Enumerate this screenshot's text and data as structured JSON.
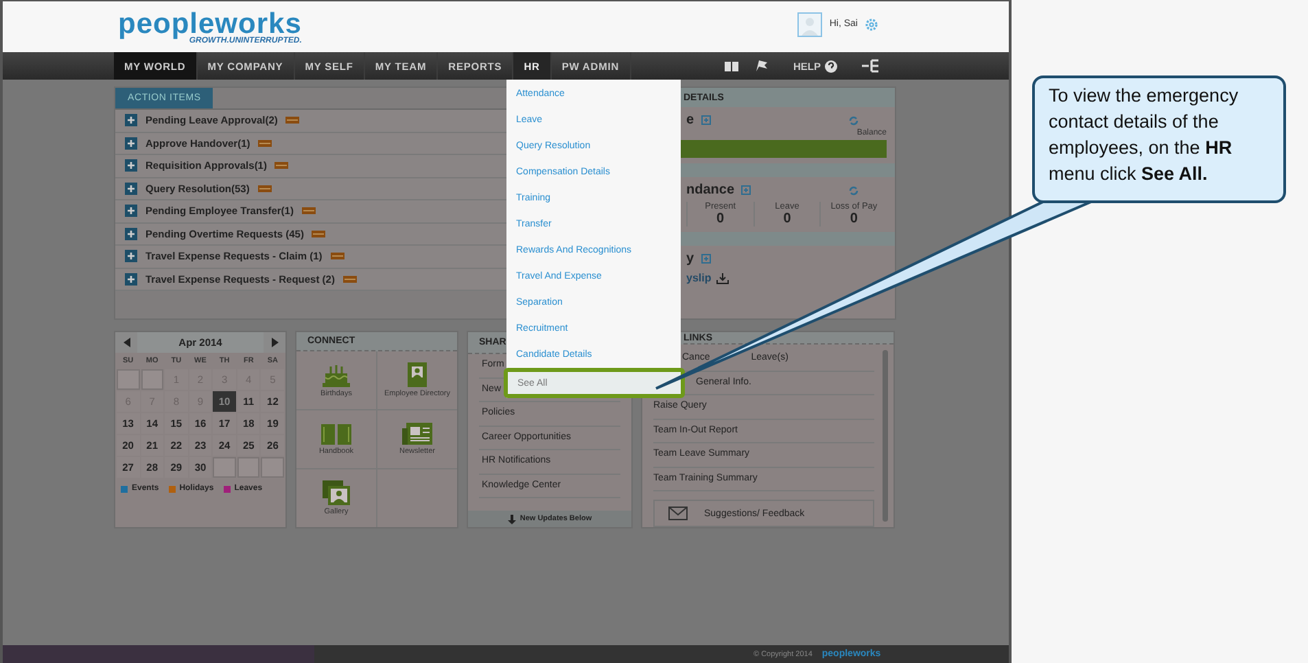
{
  "header": {
    "logo_main": "peopleworks",
    "tagline": "GROWTH.UNINTERRUPTED.",
    "greeting": "Hi, Sai"
  },
  "nav": {
    "items": [
      {
        "label": "MY WORLD",
        "selected": true,
        "open": false
      },
      {
        "label": "MY COMPANY",
        "selected": false,
        "open": false
      },
      {
        "label": "MY SELF",
        "selected": false,
        "open": false
      },
      {
        "label": "MY TEAM",
        "selected": false,
        "open": false
      },
      {
        "label": "REPORTS",
        "selected": false,
        "open": false
      },
      {
        "label": "HR",
        "selected": false,
        "open": true
      },
      {
        "label": "PW ADMIN",
        "selected": false,
        "open": false
      }
    ],
    "help": "HELP"
  },
  "hr_menu": {
    "items": [
      {
        "label": "Attendance",
        "highlighted": false
      },
      {
        "label": "Leave",
        "highlighted": false
      },
      {
        "label": "Query Resolution",
        "highlighted": false
      },
      {
        "label": "Compensation Details",
        "highlighted": false
      },
      {
        "label": "Training",
        "highlighted": false
      },
      {
        "label": "Transfer",
        "highlighted": false
      },
      {
        "label": "Rewards And Recognitions",
        "highlighted": false
      },
      {
        "label": "Travel And Expense",
        "highlighted": false
      },
      {
        "label": "Separation",
        "highlighted": false
      },
      {
        "label": "Recruitment",
        "highlighted": false
      },
      {
        "label": "Candidate Details",
        "highlighted": false
      },
      {
        "label": "See All",
        "highlighted": true
      }
    ]
  },
  "action_items": {
    "title": "ACTION ITEMS",
    "items": [
      {
        "label": "Pending Leave Approval(2)"
      },
      {
        "label": "Approve Handover(1)"
      },
      {
        "label": "Requisition Approvals(1)"
      },
      {
        "label": "Query Resolution(53)"
      },
      {
        "label": "Pending Employee Transfer(1)"
      },
      {
        "label": "Pending Overtime Requests (45)"
      },
      {
        "label": "Travel Expense Requests - Claim (1)"
      },
      {
        "label": "Travel Expense Requests - Request (2)"
      }
    ]
  },
  "details": {
    "title": "DETAILS",
    "leave": {
      "title": "e",
      "balance_label": "Balance"
    },
    "attendance": {
      "title": "ndance",
      "stats": [
        {
          "label": "Present",
          "value": "0"
        },
        {
          "label": "Leave",
          "value": "0"
        },
        {
          "label": "Loss of Pay",
          "value": "0"
        }
      ]
    },
    "payslip": {
      "title": "y",
      "link": "yslip"
    }
  },
  "calendar": {
    "month": "Apr 2014",
    "weekdays": [
      "SU",
      "MO",
      "TU",
      "WE",
      "TH",
      "FR",
      "SA"
    ],
    "weeks": [
      [
        {
          "kind": "blank"
        },
        {
          "kind": "blank"
        },
        {
          "kind": "day",
          "label": "1",
          "past": true,
          "selected": false
        },
        {
          "kind": "day",
          "label": "2",
          "past": true,
          "selected": false
        },
        {
          "kind": "day",
          "label": "3",
          "past": true,
          "selected": false
        },
        {
          "kind": "day",
          "label": "4",
          "past": true,
          "selected": false
        },
        {
          "kind": "day",
          "label": "5",
          "past": true,
          "selected": false
        }
      ],
      [
        {
          "kind": "day",
          "label": "6",
          "past": true,
          "selected": false
        },
        {
          "kind": "day",
          "label": "7",
          "past": true,
          "selected": false
        },
        {
          "kind": "day",
          "label": "8",
          "past": true,
          "selected": false
        },
        {
          "kind": "day",
          "label": "9",
          "past": true,
          "selected": false
        },
        {
          "kind": "day",
          "label": "10",
          "past": false,
          "selected": true
        },
        {
          "kind": "day",
          "label": "11",
          "past": false,
          "selected": false
        },
        {
          "kind": "day",
          "label": "12",
          "past": false,
          "selected": false
        }
      ],
      [
        {
          "kind": "day",
          "label": "13",
          "past": false,
          "selected": false
        },
        {
          "kind": "day",
          "label": "14",
          "past": false,
          "selected": false
        },
        {
          "kind": "day",
          "label": "15",
          "past": false,
          "selected": false
        },
        {
          "kind": "day",
          "label": "16",
          "past": false,
          "selected": false
        },
        {
          "kind": "day",
          "label": "17",
          "past": false,
          "selected": false
        },
        {
          "kind": "day",
          "label": "18",
          "past": false,
          "selected": false
        },
        {
          "kind": "day",
          "label": "19",
          "past": false,
          "selected": false
        }
      ],
      [
        {
          "kind": "day",
          "label": "20",
          "past": false,
          "selected": false
        },
        {
          "kind": "day",
          "label": "21",
          "past": false,
          "selected": false
        },
        {
          "kind": "day",
          "label": "22",
          "past": false,
          "selected": false
        },
        {
          "kind": "day",
          "label": "23",
          "past": false,
          "selected": false
        },
        {
          "kind": "day",
          "label": "24",
          "past": false,
          "selected": false
        },
        {
          "kind": "day",
          "label": "25",
          "past": false,
          "selected": false
        },
        {
          "kind": "day",
          "label": "26",
          "past": false,
          "selected": false
        }
      ],
      [
        {
          "kind": "day",
          "label": "27",
          "past": false,
          "selected": false
        },
        {
          "kind": "day",
          "label": "28",
          "past": false,
          "selected": false
        },
        {
          "kind": "day",
          "label": "29",
          "past": false,
          "selected": false
        },
        {
          "kind": "day",
          "label": "30",
          "past": false,
          "selected": false
        },
        {
          "kind": "blank"
        },
        {
          "kind": "blank"
        },
        {
          "kind": "blank"
        }
      ]
    ],
    "legend": [
      {
        "label": "Events",
        "color": "#1f6f9f"
      },
      {
        "label": "Holidays",
        "color": "#b0600f"
      },
      {
        "label": "Leaves",
        "color": "#a0207a"
      }
    ]
  },
  "connect": {
    "title": "CONNECT",
    "tiles": [
      {
        "label": "Birthdays",
        "kind": "cake"
      },
      {
        "label": "Employee Directory",
        "kind": "directory"
      },
      {
        "label": "Handbook",
        "kind": "book"
      },
      {
        "label": "Newsletter",
        "kind": "newspaper"
      },
      {
        "label": "Gallery",
        "kind": "gallery"
      }
    ]
  },
  "shared": {
    "title": "SHAR",
    "items": [
      "Form",
      "New",
      "Policies",
      "Career Opportunities",
      "HR Notifications",
      "Knowledge Center"
    ],
    "footer": "New Updates Below"
  },
  "quick_links": {
    "title": "LINKS",
    "items": [
      [
        "Cance",
        "Leave(s)"
      ],
      [
        "General Info."
      ],
      [
        "Raise Query"
      ],
      [
        "Team In-Out Report"
      ],
      [
        "Team Leave Summary"
      ],
      [
        "Team Training Summary"
      ]
    ],
    "feedback": "Suggestions/ Feedback"
  },
  "footer": {
    "copyright": "© Copyright 2014",
    "logo": "peopleworks"
  },
  "callout": {
    "text": "To view the emergency contact details of the employees, on the **HR** menu click **See All.**"
  }
}
